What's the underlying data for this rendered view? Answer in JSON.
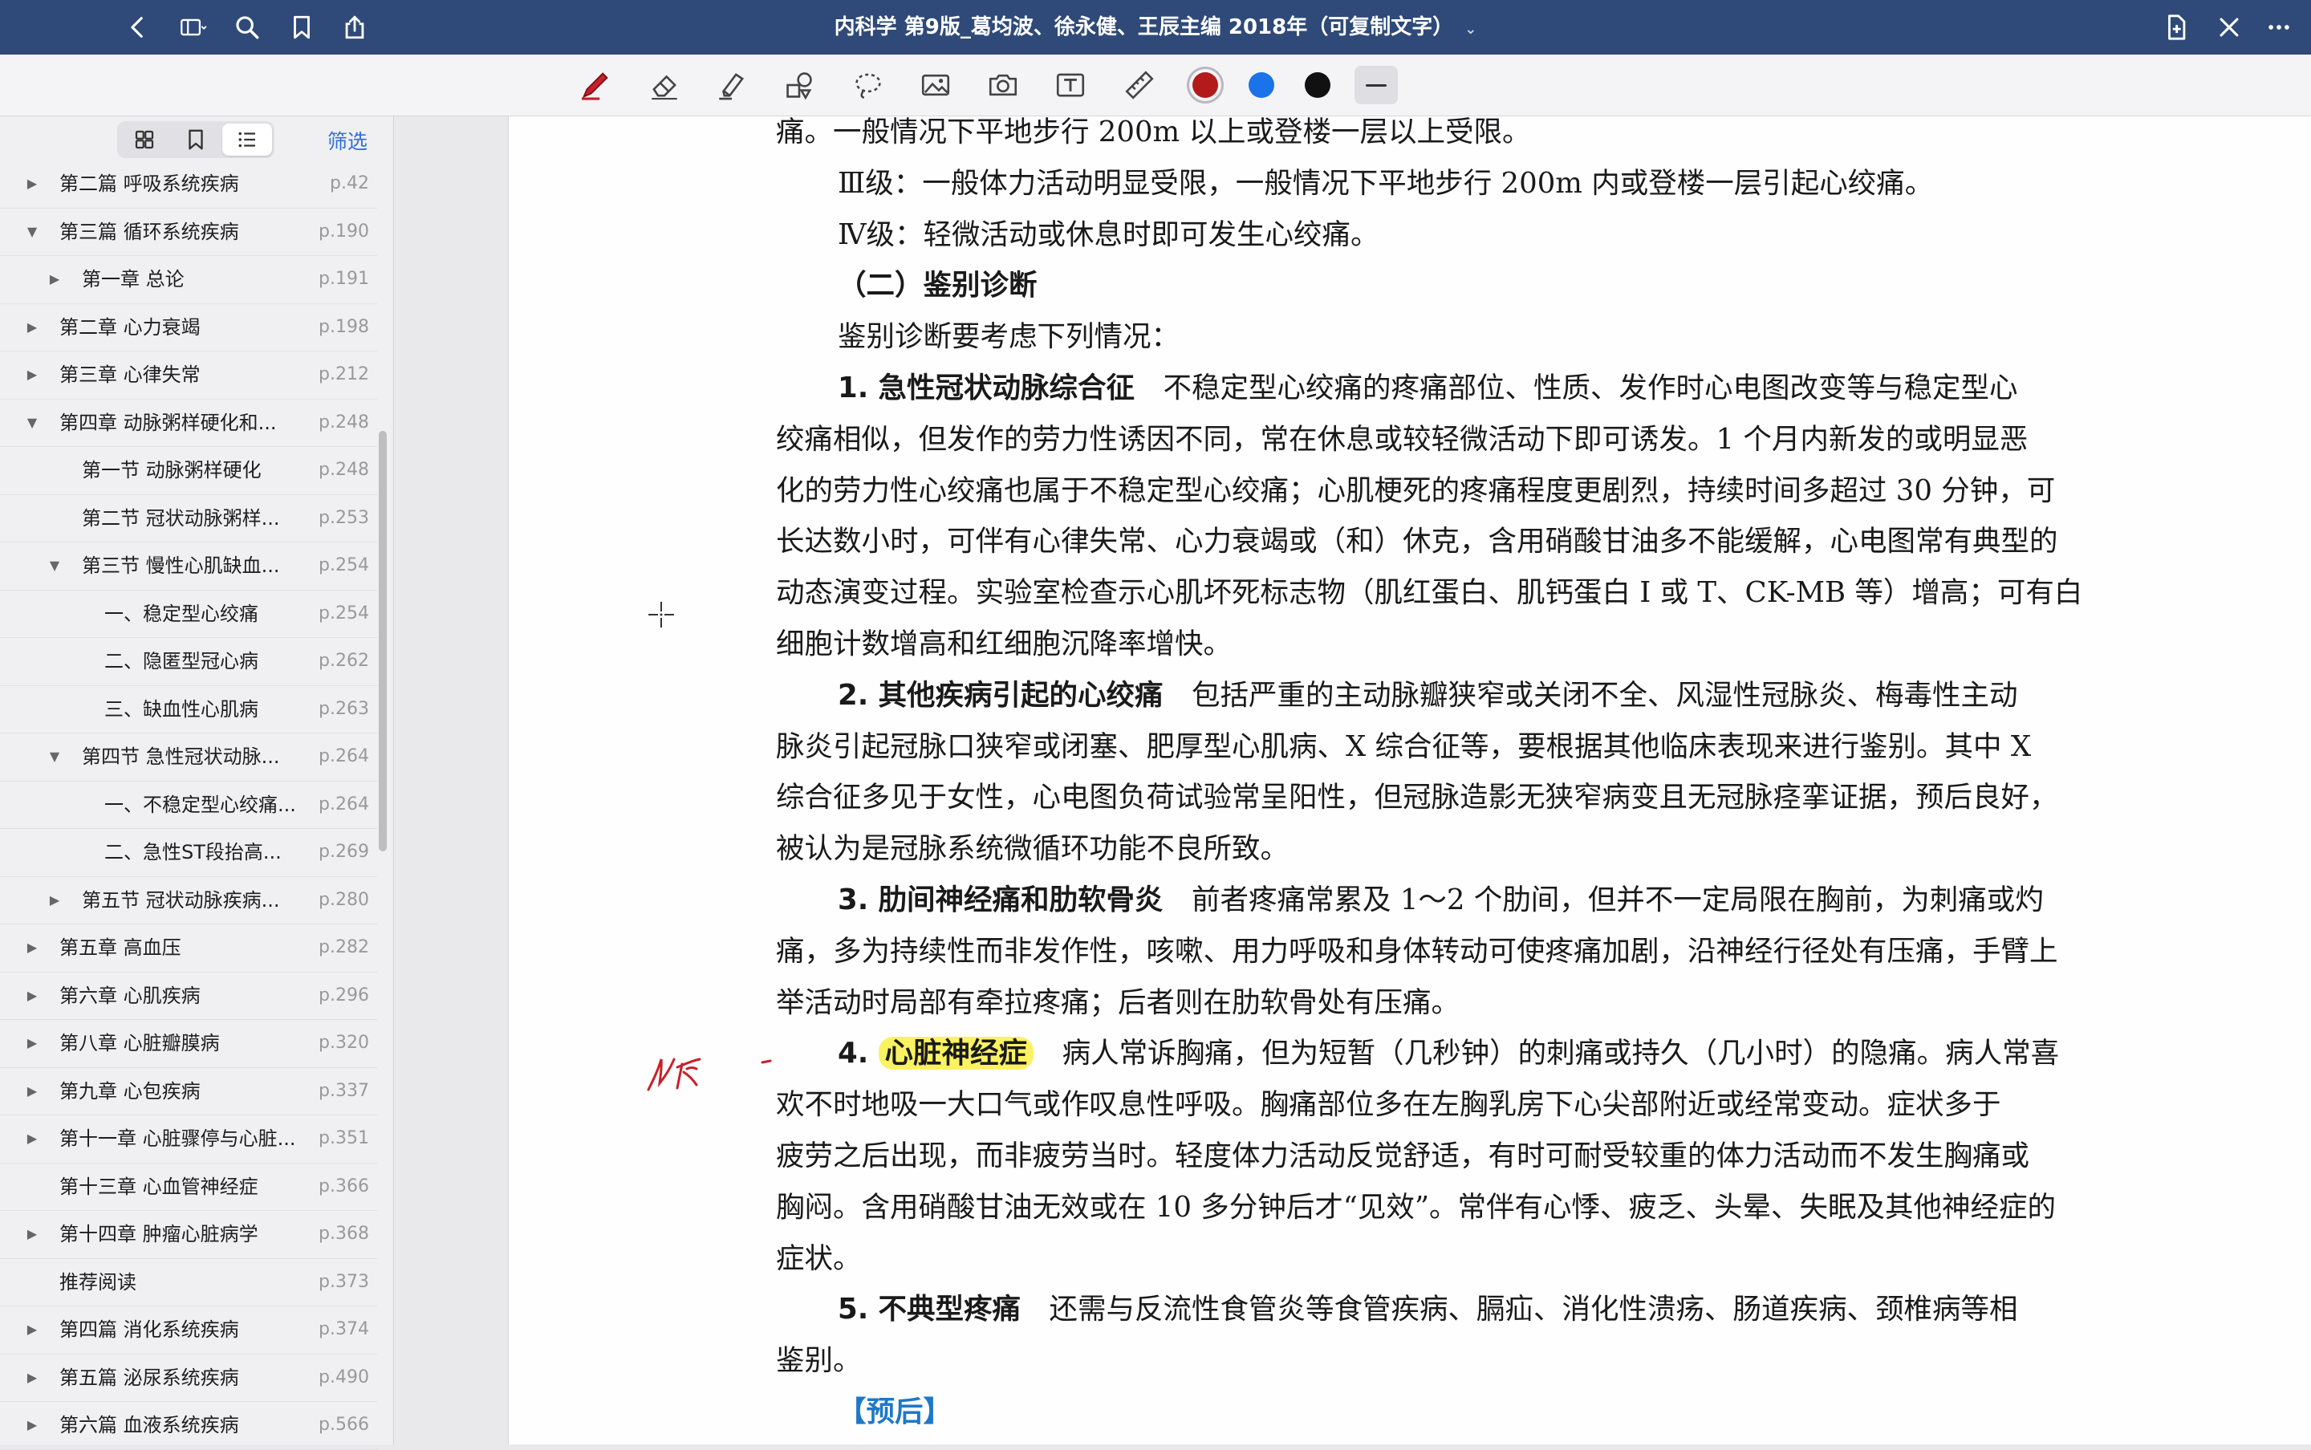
{
  "titlebar": {
    "title": "内科学 第9版_葛均波、徐永健、王辰主编 2018年（可复制文字）",
    "icons": [
      "back-chevron-icon",
      "sidebar-toggle-icon",
      "search-icon",
      "bookmark-icon",
      "share-icon",
      "add-page-icon",
      "close-icon",
      "more-icon"
    ]
  },
  "toolbar": {
    "colors": {
      "red": "#b31b1b",
      "blue": "#1a73e8",
      "black": "#111111"
    },
    "active_color": "red",
    "tools": [
      "pen-icon",
      "eraser-icon",
      "highlighter-icon",
      "shapes-icon",
      "lasso-icon",
      "image-icon",
      "camera-icon",
      "text-box-icon",
      "ruler-icon"
    ]
  },
  "sidebar": {
    "filter_label": "筛选",
    "toc": [
      {
        "label": "第二篇 呼吸系统疾病",
        "page": "p.42",
        "level": 0,
        "state": "collapsed"
      },
      {
        "label": "第三篇 循环系统疾病",
        "page": "p.190",
        "level": 0,
        "state": "expanded"
      },
      {
        "label": "第一章 总论",
        "page": "p.191",
        "level": 1,
        "state": "collapsed"
      },
      {
        "label": "第二章 心力衰竭",
        "page": "p.198",
        "level": 0,
        "state": "collapsed"
      },
      {
        "label": "第三章 心律失常",
        "page": "p.212",
        "level": 0,
        "state": "collapsed"
      },
      {
        "label": "第四章 动脉粥样硬化和...",
        "page": "p.248",
        "level": 0,
        "state": "expanded"
      },
      {
        "label": "第一节 动脉粥样硬化",
        "page": "p.248",
        "level": 1,
        "state": "none"
      },
      {
        "label": "第二节 冠状动脉粥样...",
        "page": "p.253",
        "level": 1,
        "state": "none"
      },
      {
        "label": "第三节 慢性心肌缺血...",
        "page": "p.254",
        "level": 1,
        "state": "expanded"
      },
      {
        "label": "一、稳定型心绞痛",
        "page": "p.254",
        "level": 2,
        "state": "none"
      },
      {
        "label": "二、隐匿型冠心病",
        "page": "p.262",
        "level": 2,
        "state": "none"
      },
      {
        "label": "三、缺血性心肌病",
        "page": "p.263",
        "level": 2,
        "state": "none"
      },
      {
        "label": "第四节 急性冠状动脉...",
        "page": "p.264",
        "level": 1,
        "state": "expanded"
      },
      {
        "label": "一、不稳定型心绞痛...",
        "page": "p.264",
        "level": 2,
        "state": "none"
      },
      {
        "label": "二、急性ST段抬高...",
        "page": "p.269",
        "level": 2,
        "state": "none"
      },
      {
        "label": "第五节 冠状动脉疾病...",
        "page": "p.280",
        "level": 1,
        "state": "collapsed"
      },
      {
        "label": "第五章 高血压",
        "page": "p.282",
        "level": 0,
        "state": "collapsed"
      },
      {
        "label": "第六章 心肌疾病",
        "page": "p.296",
        "level": 0,
        "state": "collapsed"
      },
      {
        "label": "第八章 心脏瓣膜病",
        "page": "p.320",
        "level": 0,
        "state": "collapsed"
      },
      {
        "label": "第九章 心包疾病",
        "page": "p.337",
        "level": 0,
        "state": "collapsed"
      },
      {
        "label": "第十一章 心脏骤停与心脏...",
        "page": "p.351",
        "level": 0,
        "state": "collapsed"
      },
      {
        "label": "第十三章 心血管神经症",
        "page": "p.366",
        "level": 0,
        "state": "none"
      },
      {
        "label": "第十四章 肿瘤心脏病学",
        "page": "p.368",
        "level": 0,
        "state": "collapsed"
      },
      {
        "label": "推荐阅读",
        "page": "p.373",
        "level": 0,
        "state": "none"
      },
      {
        "label": "第四篇 消化系统疾病",
        "page": "p.374",
        "level": 0,
        "state": "collapsed"
      },
      {
        "label": "第五篇 泌尿系统疾病",
        "page": "p.490",
        "level": 0,
        "state": "collapsed"
      },
      {
        "label": "第六篇 血液系统疾病",
        "page": "p.566",
        "level": 0,
        "state": "collapsed"
      }
    ]
  },
  "page": {
    "lines": [
      {
        "indent": 0,
        "segs": [
          {
            "t": "痛。一般情况下平地步行 200m 以上或登楼一层以上受限。"
          }
        ]
      },
      {
        "indent": 1,
        "segs": [
          {
            "t": "Ⅲ级：一般体力活动明显受限，一般情况下平地步行 200m 内或登楼一层引起心绞痛。"
          }
        ]
      },
      {
        "indent": 1,
        "segs": [
          {
            "t": "Ⅳ级：轻微活动或休息时即可发生心绞痛。"
          }
        ]
      },
      {
        "indent": 1,
        "segs": [
          {
            "t": "（二）鉴别诊断",
            "c": "b"
          }
        ]
      },
      {
        "indent": 1,
        "segs": [
          {
            "t": "鉴别诊断要考虑下列情况："
          }
        ]
      },
      {
        "indent": 1,
        "segs": [
          {
            "t": "1. 急性冠状动脉综合征",
            "c": "b"
          },
          {
            "t": "　不稳定型心绞痛的疼痛部位、性质、发作时心电图改变等与稳定型心"
          }
        ]
      },
      {
        "indent": 0,
        "segs": [
          {
            "t": "绞痛相似，但发作的劳力性诱因不同，常在休息或较轻微活动下即可诱发。1 个月内新发的或明显恶"
          }
        ]
      },
      {
        "indent": 0,
        "segs": [
          {
            "t": "化的劳力性心绞痛也属于不稳定型心绞痛；心肌梗死的疼痛程度更剧烈，持续时间多超过 30 分钟，可"
          }
        ]
      },
      {
        "indent": 0,
        "segs": [
          {
            "t": "长达数小时，可伴有心律失常、心力衰竭或（和）休克，含用硝酸甘油多不能缓解，心电图常有典型的"
          }
        ]
      },
      {
        "indent": 0,
        "segs": [
          {
            "t": "动态演变过程。实验室检查示心肌坏死标志物（肌红蛋白、肌钙蛋白 I 或 T、CK-MB 等）增高；可有白"
          }
        ]
      },
      {
        "indent": 0,
        "segs": [
          {
            "t": "细胞计数增高和红细胞沉降率增快。"
          }
        ]
      },
      {
        "indent": 1,
        "segs": [
          {
            "t": "2. 其他疾病引起的心绞痛",
            "c": "b"
          },
          {
            "t": "　包括严重的主动脉瓣狭窄或关闭不全、风湿性冠脉炎、梅毒性主动"
          }
        ]
      },
      {
        "indent": 0,
        "segs": [
          {
            "t": "脉炎引起冠脉口狭窄或闭塞、肥厚型心肌病、X 综合征等，要根据其他临床表现来进行鉴别。其中 X"
          }
        ]
      },
      {
        "indent": 0,
        "segs": [
          {
            "t": "综合征多见于女性，心电图负荷试验常呈阳性，但冠脉造影无狭窄病变且无冠脉痉挛证据，预后良好，"
          }
        ]
      },
      {
        "indent": 0,
        "segs": [
          {
            "t": "被认为是冠脉系统微循环功能不良所致。"
          }
        ]
      },
      {
        "indent": 1,
        "segs": [
          {
            "t": "3. 肋间神经痛和肋软骨炎",
            "c": "b"
          },
          {
            "t": "　前者疼痛常累及 1～2 个肋间，但并不一定局限在胸前，为刺痛或灼"
          }
        ]
      },
      {
        "indent": 0,
        "segs": [
          {
            "t": "痛，多为持续性而非发作性，咳嗽、用力呼吸和身体转动可使疼痛加剧，沿神经行径处有压痛，手臂上"
          }
        ]
      },
      {
        "indent": 0,
        "segs": [
          {
            "t": "举活动时局部有牵拉疼痛；后者则在肋软骨处有压痛。"
          }
        ]
      },
      {
        "indent": 1,
        "segs": [
          {
            "t": "4. ",
            "c": "b"
          },
          {
            "t": "心脏神经症",
            "c": "b hl"
          },
          {
            "t": "　病人常诉胸痛，但为短暂（几秒钟）的刺痛或持久（几小时）的隐痛。病人常喜"
          }
        ]
      },
      {
        "indent": 0,
        "segs": [
          {
            "t": "欢不时地吸一大口气或作叹息性呼吸。胸痛部位多在左胸乳房下心尖部附近或经常变动。症状多于"
          }
        ]
      },
      {
        "indent": 0,
        "segs": [
          {
            "t": "疲劳之后出现，而非疲劳当时。轻度体力活动反觉舒适，有时可耐受较重的体力活动而不发生胸痛或"
          }
        ]
      },
      {
        "indent": 0,
        "segs": [
          {
            "t": "胸闷。含用硝酸甘油无效或在 10 多分钟后才“见效”。常伴有心悸、疲乏、头晕、失眠及其他神经症的"
          }
        ]
      },
      {
        "indent": 0,
        "segs": [
          {
            "t": "症状。"
          }
        ]
      },
      {
        "indent": 1,
        "segs": [
          {
            "t": "5. 不典型疼痛",
            "c": "b"
          },
          {
            "t": "　还需与反流性食管炎等食管疾病、膈疝、消化性溃疡、肠道疾病、颈椎病等相"
          }
        ]
      },
      {
        "indent": 0,
        "segs": [
          {
            "t": "鉴别。"
          }
        ]
      },
      {
        "indent": 1,
        "segs": [
          {
            "t": "【预后】",
            "c": "b blue"
          }
        ]
      }
    ]
  }
}
